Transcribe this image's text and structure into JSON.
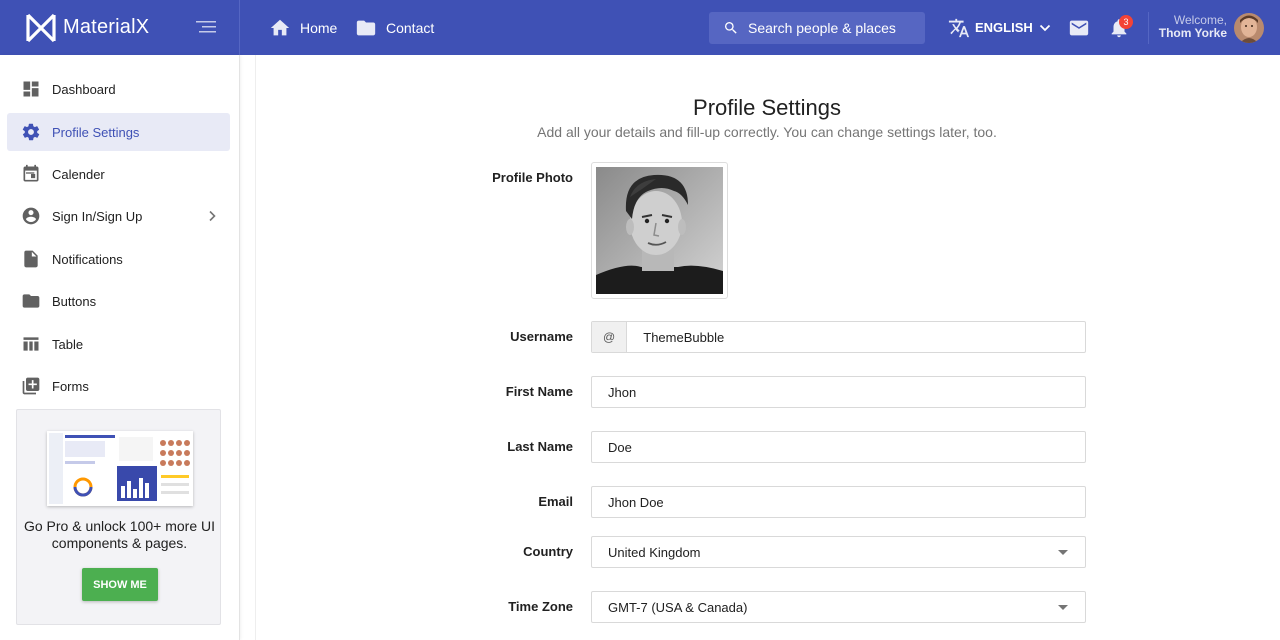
{
  "app": {
    "name": "MaterialX"
  },
  "header": {
    "nav": [
      {
        "label": "Home",
        "icon": "home-icon"
      },
      {
        "label": "Contact",
        "icon": "folder-icon"
      }
    ],
    "search": {
      "placeholder": "Search people & places"
    },
    "language": "ENGLISH",
    "notifications_count": "3",
    "user": {
      "welcome": "Welcome,",
      "name": "Thom Yorke"
    }
  },
  "sidebar": {
    "items": [
      {
        "label": "Dashboard",
        "icon": "dashboard-icon",
        "active": false
      },
      {
        "label": "Profile Settings",
        "icon": "gear-icon",
        "active": true
      },
      {
        "label": "Calender",
        "icon": "calendar-icon",
        "active": false
      },
      {
        "label": "Sign In/Sign Up",
        "icon": "account-circle-icon",
        "active": false,
        "has_submenu": true
      },
      {
        "label": "Notifications",
        "icon": "file-icon",
        "active": false
      },
      {
        "label": "Buttons",
        "icon": "folder-icon",
        "active": false
      },
      {
        "label": "Table",
        "icon": "table-icon",
        "active": false
      },
      {
        "label": "Forms",
        "icon": "add-box-icon",
        "active": false
      }
    ],
    "promo": {
      "text": "Go Pro & unlock 100+ more UI components & pages.",
      "button": "SHOW ME"
    }
  },
  "page": {
    "title": "Profile Settings",
    "subtitle": "Add all your details and fill-up correctly. You can change settings later, too.",
    "fields": {
      "photo_label": "Profile Photo",
      "username": {
        "label": "Username",
        "prefix": "@",
        "value": "ThemeBubble"
      },
      "first_name": {
        "label": "First Name",
        "value": "Jhon"
      },
      "last_name": {
        "label": "Last Name",
        "value": "Doe"
      },
      "email": {
        "label": "Email",
        "value": "Jhon Doe"
      },
      "country": {
        "label": "Country",
        "value": "United Kingdom"
      },
      "timezone": {
        "label": "Time Zone",
        "value": "GMT-7 (USA & Canada)"
      }
    }
  },
  "colors": {
    "primary": "#3f51b5",
    "active_bg": "#e8eaf6",
    "promo_button": "#4caf50",
    "badge": "#f44336"
  }
}
